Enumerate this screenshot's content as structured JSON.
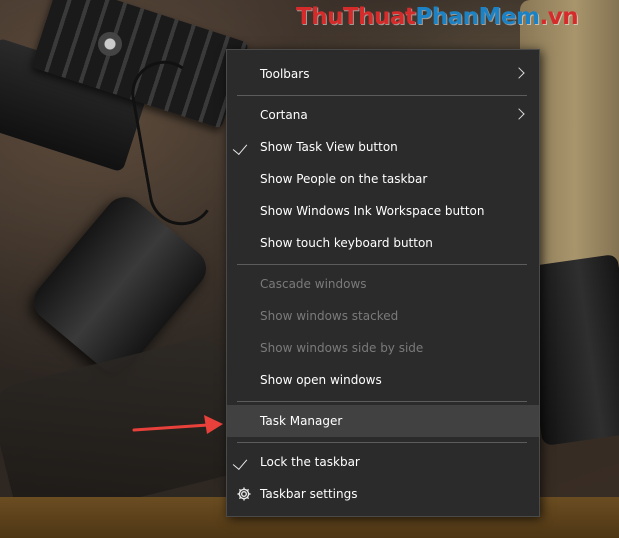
{
  "watermark": {
    "part1": "ThuThuat",
    "part2": "PhanMem",
    "part3": ".vn"
  },
  "context_menu": {
    "items": [
      {
        "label": "Toolbars",
        "submenu": true
      },
      {
        "label": "Cortana",
        "submenu": true
      },
      {
        "label": "Show Task View button",
        "checked": true
      },
      {
        "label": "Show People on the taskbar"
      },
      {
        "label": "Show Windows Ink Workspace button"
      },
      {
        "label": "Show touch keyboard button"
      },
      {
        "label": "Cascade windows",
        "disabled": true
      },
      {
        "label": "Show windows stacked",
        "disabled": true
      },
      {
        "label": "Show windows side by side",
        "disabled": true
      },
      {
        "label": "Show open windows"
      },
      {
        "label": "Task Manager",
        "highlighted": true
      },
      {
        "label": "Lock the taskbar",
        "checked": true
      },
      {
        "label": "Taskbar settings",
        "icon": "gear-icon"
      }
    ]
  },
  "annotation": {
    "arrow_color": "#e8403a",
    "points_to": "Task Manager"
  },
  "colors": {
    "menu_background": "#2b2b2b",
    "menu_hover": "#414141",
    "disabled_text": "#7a7a7a",
    "watermark_red": "#d62b2b",
    "watermark_blue": "#1d82c4"
  }
}
